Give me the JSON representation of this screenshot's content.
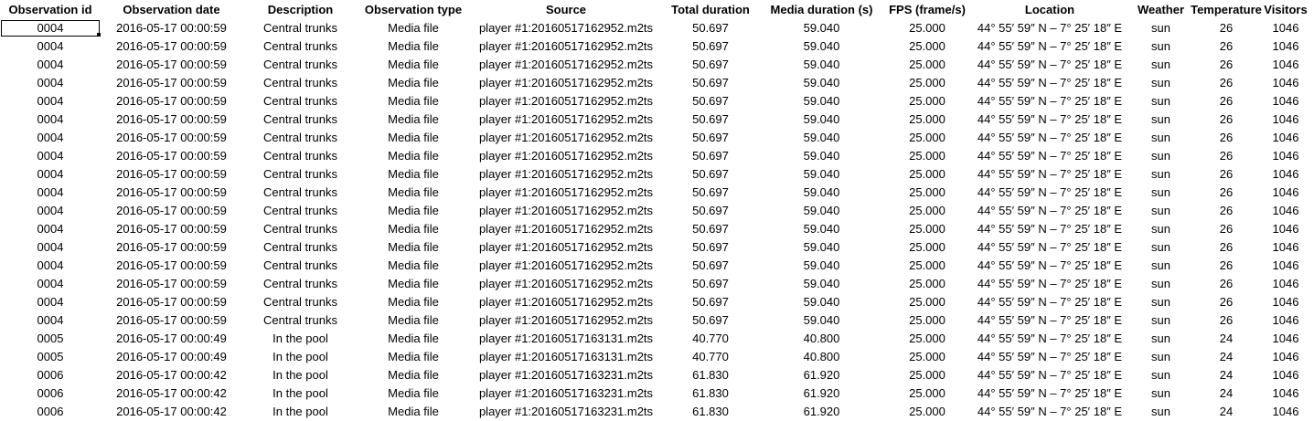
{
  "columns": [
    "Observation id",
    "Observation date",
    "Description",
    "Observation type",
    "Source",
    "Total duration",
    "Media duration (s)",
    "FPS (frame/s)",
    "Location",
    "Weather",
    "Temperature",
    "Visitors"
  ],
  "selected_cell": {
    "row": 0,
    "col": 0
  },
  "rows": [
    [
      "0004",
      "2016-05-17 00:00:59",
      "Central trunks",
      "Media file",
      "player #1:20160517162952.m2ts",
      "50.697",
      "59.040",
      "25.000",
      "44° 55′ 59″ N – 7° 25′ 18″ E",
      "sun",
      "26",
      "1046"
    ],
    [
      "0004",
      "2016-05-17 00:00:59",
      "Central trunks",
      "Media file",
      "player #1:20160517162952.m2ts",
      "50.697",
      "59.040",
      "25.000",
      "44° 55′ 59″ N – 7° 25′ 18″ E",
      "sun",
      "26",
      "1046"
    ],
    [
      "0004",
      "2016-05-17 00:00:59",
      "Central trunks",
      "Media file",
      "player #1:20160517162952.m2ts",
      "50.697",
      "59.040",
      "25.000",
      "44° 55′ 59″ N – 7° 25′ 18″ E",
      "sun",
      "26",
      "1046"
    ],
    [
      "0004",
      "2016-05-17 00:00:59",
      "Central trunks",
      "Media file",
      "player #1:20160517162952.m2ts",
      "50.697",
      "59.040",
      "25.000",
      "44° 55′ 59″ N – 7° 25′ 18″ E",
      "sun",
      "26",
      "1046"
    ],
    [
      "0004",
      "2016-05-17 00:00:59",
      "Central trunks",
      "Media file",
      "player #1:20160517162952.m2ts",
      "50.697",
      "59.040",
      "25.000",
      "44° 55′ 59″ N – 7° 25′ 18″ E",
      "sun",
      "26",
      "1046"
    ],
    [
      "0004",
      "2016-05-17 00:00:59",
      "Central trunks",
      "Media file",
      "player #1:20160517162952.m2ts",
      "50.697",
      "59.040",
      "25.000",
      "44° 55′ 59″ N – 7° 25′ 18″ E",
      "sun",
      "26",
      "1046"
    ],
    [
      "0004",
      "2016-05-17 00:00:59",
      "Central trunks",
      "Media file",
      "player #1:20160517162952.m2ts",
      "50.697",
      "59.040",
      "25.000",
      "44° 55′ 59″ N – 7° 25′ 18″ E",
      "sun",
      "26",
      "1046"
    ],
    [
      "0004",
      "2016-05-17 00:00:59",
      "Central trunks",
      "Media file",
      "player #1:20160517162952.m2ts",
      "50.697",
      "59.040",
      "25.000",
      "44° 55′ 59″ N – 7° 25′ 18″ E",
      "sun",
      "26",
      "1046"
    ],
    [
      "0004",
      "2016-05-17 00:00:59",
      "Central trunks",
      "Media file",
      "player #1:20160517162952.m2ts",
      "50.697",
      "59.040",
      "25.000",
      "44° 55′ 59″ N – 7° 25′ 18″ E",
      "sun",
      "26",
      "1046"
    ],
    [
      "0004",
      "2016-05-17 00:00:59",
      "Central trunks",
      "Media file",
      "player #1:20160517162952.m2ts",
      "50.697",
      "59.040",
      "25.000",
      "44° 55′ 59″ N – 7° 25′ 18″ E",
      "sun",
      "26",
      "1046"
    ],
    [
      "0004",
      "2016-05-17 00:00:59",
      "Central trunks",
      "Media file",
      "player #1:20160517162952.m2ts",
      "50.697",
      "59.040",
      "25.000",
      "44° 55′ 59″ N – 7° 25′ 18″ E",
      "sun",
      "26",
      "1046"
    ],
    [
      "0004",
      "2016-05-17 00:00:59",
      "Central trunks",
      "Media file",
      "player #1:20160517162952.m2ts",
      "50.697",
      "59.040",
      "25.000",
      "44° 55′ 59″ N – 7° 25′ 18″ E",
      "sun",
      "26",
      "1046"
    ],
    [
      "0004",
      "2016-05-17 00:00:59",
      "Central trunks",
      "Media file",
      "player #1:20160517162952.m2ts",
      "50.697",
      "59.040",
      "25.000",
      "44° 55′ 59″ N – 7° 25′ 18″ E",
      "sun",
      "26",
      "1046"
    ],
    [
      "0004",
      "2016-05-17 00:00:59",
      "Central trunks",
      "Media file",
      "player #1:20160517162952.m2ts",
      "50.697",
      "59.040",
      "25.000",
      "44° 55′ 59″ N – 7° 25′ 18″ E",
      "sun",
      "26",
      "1046"
    ],
    [
      "0004",
      "2016-05-17 00:00:59",
      "Central trunks",
      "Media file",
      "player #1:20160517162952.m2ts",
      "50.697",
      "59.040",
      "25.000",
      "44° 55′ 59″ N – 7° 25′ 18″ E",
      "sun",
      "26",
      "1046"
    ],
    [
      "0004",
      "2016-05-17 00:00:59",
      "Central trunks",
      "Media file",
      "player #1:20160517162952.m2ts",
      "50.697",
      "59.040",
      "25.000",
      "44° 55′ 59″ N – 7° 25′ 18″ E",
      "sun",
      "26",
      "1046"
    ],
    [
      "0004",
      "2016-05-17 00:00:59",
      "Central trunks",
      "Media file",
      "player #1:20160517162952.m2ts",
      "50.697",
      "59.040",
      "25.000",
      "44° 55′ 59″ N – 7° 25′ 18″ E",
      "sun",
      "26",
      "1046"
    ],
    [
      "0005",
      "2016-05-17 00:00:49",
      "In the pool",
      "Media file",
      "player #1:20160517163131.m2ts",
      "40.770",
      "40.800",
      "25.000",
      "44° 55′ 59″ N – 7° 25′ 18″ E",
      "sun",
      "24",
      "1046"
    ],
    [
      "0005",
      "2016-05-17 00:00:49",
      "In the pool",
      "Media file",
      "player #1:20160517163131.m2ts",
      "40.770",
      "40.800",
      "25.000",
      "44° 55′ 59″ N – 7° 25′ 18″ E",
      "sun",
      "24",
      "1046"
    ],
    [
      "0006",
      "2016-05-17 00:00:42",
      "In the pool",
      "Media file",
      "player #1:20160517163231.m2ts",
      "61.830",
      "61.920",
      "25.000",
      "44° 55′ 59″ N – 7° 25′ 18″ E",
      "sun",
      "24",
      "1046"
    ],
    [
      "0006",
      "2016-05-17 00:00:42",
      "In the pool",
      "Media file",
      "player #1:20160517163231.m2ts",
      "61.830",
      "61.920",
      "25.000",
      "44° 55′ 59″ N – 7° 25′ 18″ E",
      "sun",
      "24",
      "1046"
    ],
    [
      "0006",
      "2016-05-17 00:00:42",
      "In the pool",
      "Media file",
      "player #1:20160517163231.m2ts",
      "61.830",
      "61.920",
      "25.000",
      "44° 55′ 59″ N – 7° 25′ 18″ E",
      "sun",
      "24",
      "1046"
    ]
  ]
}
